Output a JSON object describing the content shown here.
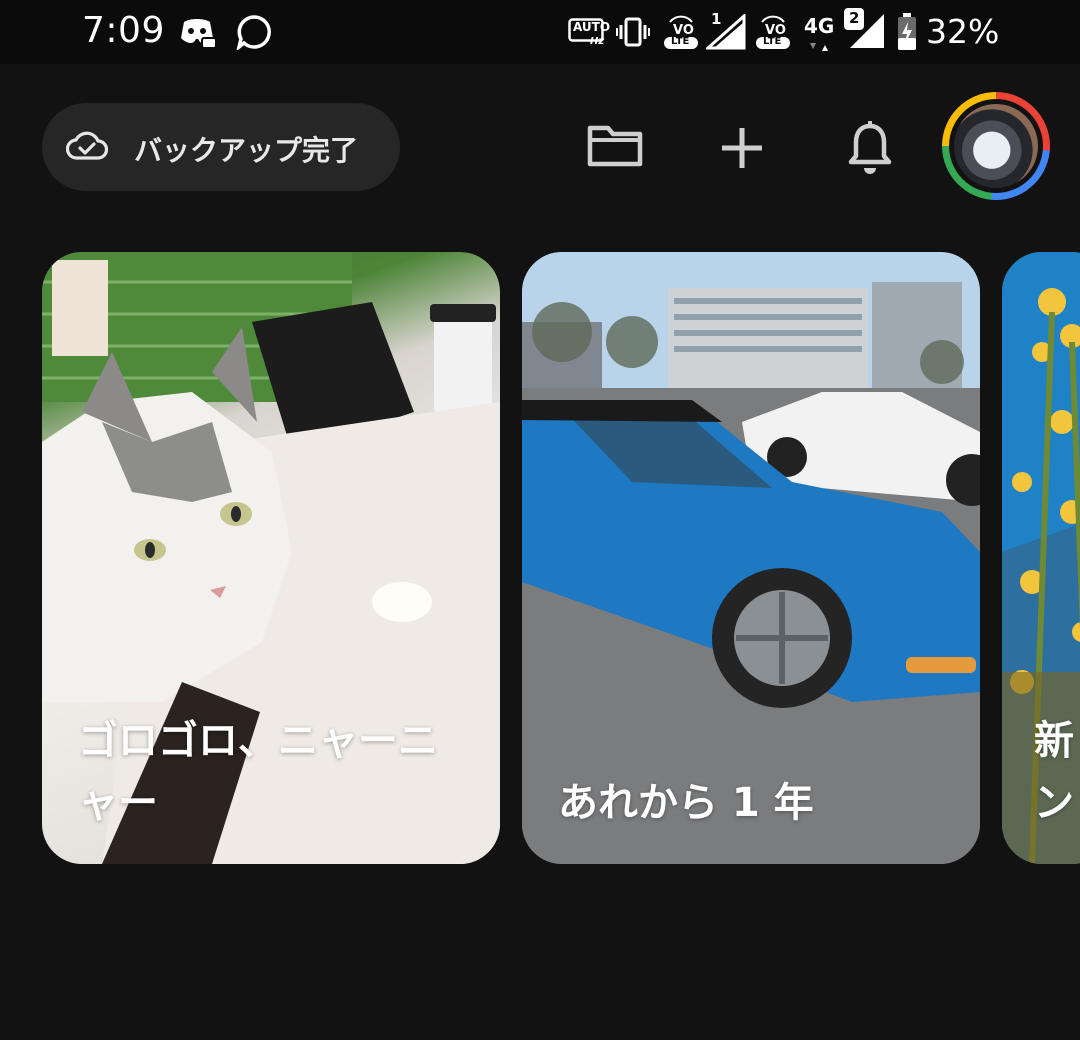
{
  "status_bar": {
    "time": "7:09",
    "left_icons": [
      "discord-icon",
      "chat-bubble-icon"
    ],
    "auto_hz_label": "AUTO",
    "auto_hz_sub": "Hz",
    "sim1_label": "1",
    "sim2_label": "2",
    "volte_label": "LTE",
    "network_label": "4G",
    "battery_percent": "32%"
  },
  "top_bar": {
    "backup_label": "バックアップ完了",
    "actions": [
      "folder-icon",
      "add-icon",
      "notifications-icon"
    ]
  },
  "memories": [
    {
      "title": "ゴロゴロ、ニャーニャー"
    },
    {
      "title": "あれから 1 年"
    },
    {
      "title": "新ン"
    }
  ],
  "colors": {
    "background": "#121212",
    "chip": "#262626",
    "google_red": "#ea4335",
    "google_blue": "#4285f4",
    "google_green": "#34a853",
    "google_yellow": "#fbbc05"
  }
}
